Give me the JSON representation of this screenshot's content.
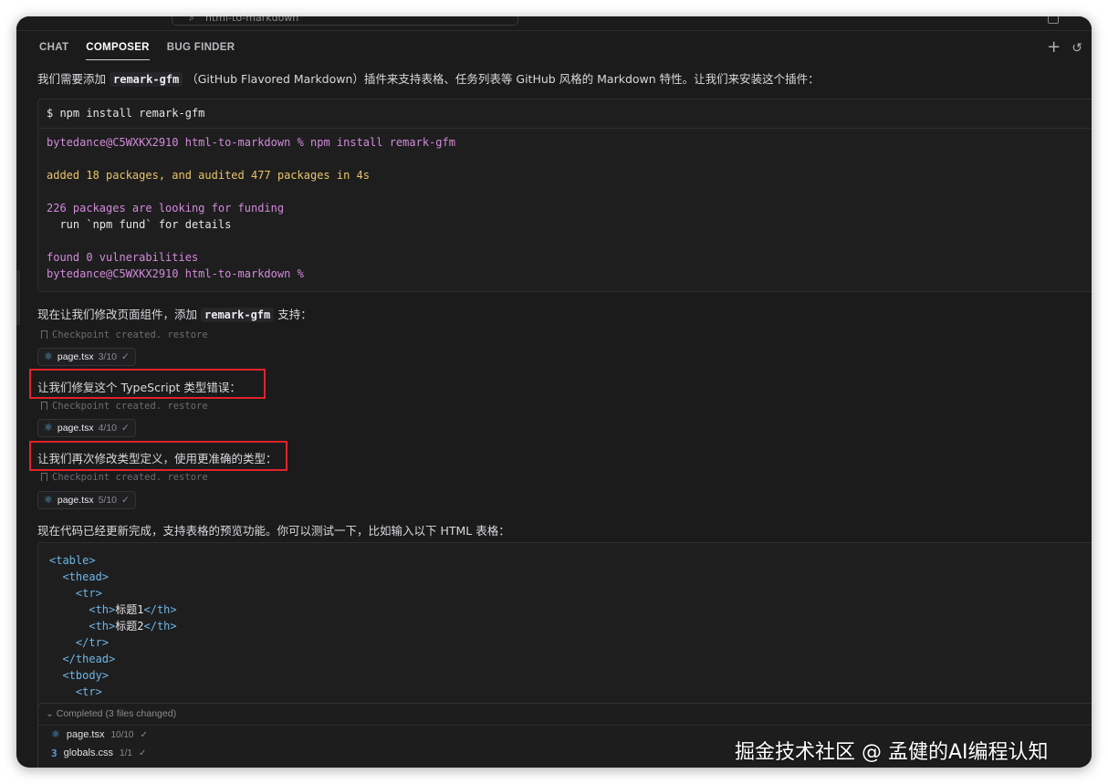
{
  "titlebar": {
    "search_text": "html-to-markdown"
  },
  "tabs": [
    {
      "label": "CHAT",
      "active": false
    },
    {
      "label": "COMPOSER",
      "active": true
    },
    {
      "label": "BUG FINDER",
      "active": false
    }
  ],
  "messages": {
    "m1_pre": "我们需要添加",
    "m1_code": "remark-gfm",
    "m1_post": "（GitHub Flavored Markdown）插件来支持表格、任务列表等 GitHub 风格的 Markdown 特性。让我们来安装这个插件：",
    "m2_pre": "现在让我们修改页面组件，添加",
    "m2_code": "remark-gfm",
    "m2_post": "支持：",
    "m3": "让我们修复这个 TypeScript 类型错误：",
    "m4": "让我们再次修改类型定义，使用更准确的类型：",
    "m5": "现在代码已经更新完成，支持表格的预览功能。你可以测试一下，比如输入以下 HTML 表格："
  },
  "terminal": {
    "command": "$ npm install remark-gfm",
    "lines": {
      "l1_prompt": "bytedance@C5WXKX2910",
      "l1_dir": "html-to-markdown",
      "l1_rest": "% npm install remark-gfm",
      "l2": "added 18 packages, and audited 477 packages in 4s",
      "l3": "226 packages are looking for funding",
      "l4": "  run `npm fund` for details",
      "l5": "found 0 vulnerabilities",
      "l6_prompt": "bytedance@C5WXKX2910",
      "l6_dir": "html-to-markdown",
      "l6_rest": "%"
    }
  },
  "checkpoints": [
    {
      "text": "Checkpoint created.",
      "action": "restore",
      "file": "page.tsx",
      "progress": "3/10"
    },
    {
      "text": "Checkpoint created.",
      "action": "restore",
      "file": "page.tsx",
      "progress": "4/10"
    },
    {
      "text": "Checkpoint created.",
      "action": "restore",
      "file": "page.tsx",
      "progress": "5/10"
    }
  ],
  "code_html": {
    "l1": "<table>",
    "l2": "<thead>",
    "l3": "<tr>",
    "l4a": "<th>",
    "l4b": "标题1",
    "l4c": "</th>",
    "l5a": "<th>",
    "l5b": "标题2",
    "l5c": "</th>",
    "l6": "</tr>",
    "l7": "</thead>",
    "l8": "<tbody>",
    "l9": "<tr>"
  },
  "completed": {
    "header": "Completed",
    "meta": "(3 files changed)",
    "files": [
      {
        "name": "page.tsx",
        "progress": "10/10"
      },
      {
        "name": "globals.css",
        "progress": "1/1"
      }
    ]
  },
  "watermark": "掘金技术社区 @ 孟健的AI编程认知",
  "colors": {
    "highlight": "#e0232a",
    "background": "#1b1b1c"
  }
}
